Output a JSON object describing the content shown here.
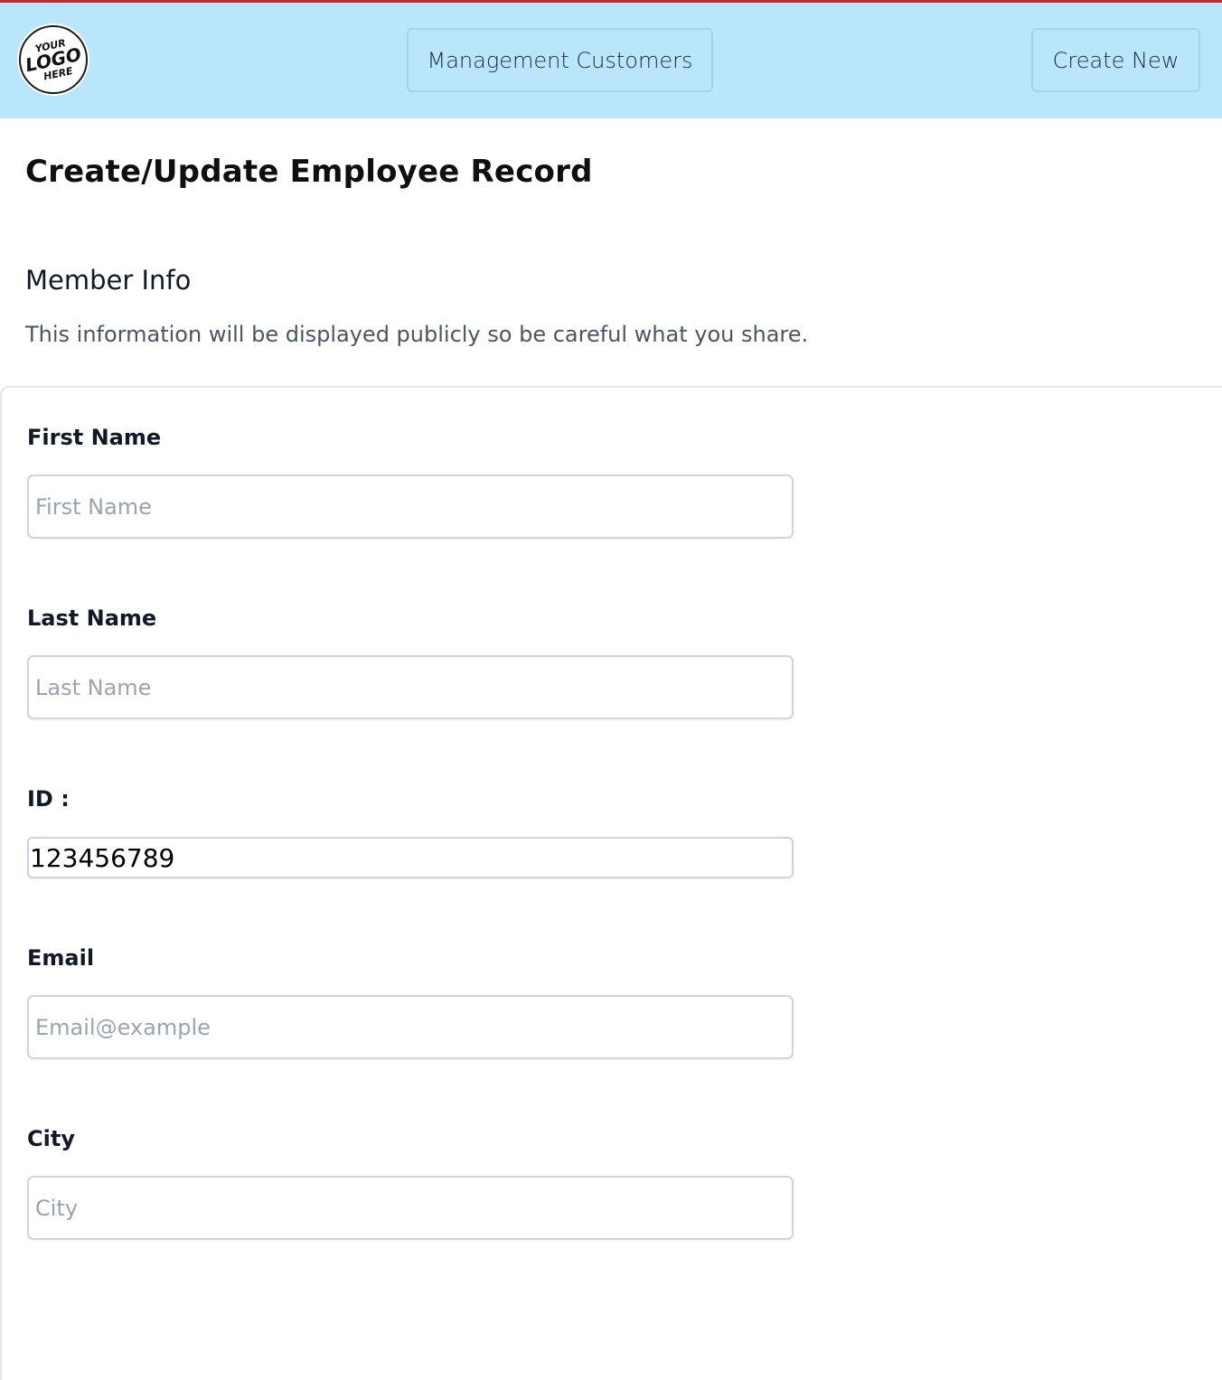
{
  "header": {
    "logo_text": [
      "YOUR",
      "LOGO",
      "HERE"
    ],
    "nav": {
      "management_label": "Management Customers",
      "create_label": "Create New"
    }
  },
  "page": {
    "title": "Create/Update Employee Record"
  },
  "section": {
    "title": "Member Info",
    "description": "This information will be displayed publicly so be careful what you share."
  },
  "form": {
    "first_name": {
      "label": "First Name",
      "placeholder": "First Name",
      "value": ""
    },
    "last_name": {
      "label": "Last Name",
      "placeholder": "Last Name",
      "value": ""
    },
    "id": {
      "label": "ID :",
      "value": "123456789"
    },
    "email": {
      "label": "Email",
      "placeholder": "Email@example",
      "value": ""
    },
    "city": {
      "label": "City",
      "placeholder": "City",
      "value": ""
    }
  },
  "colors": {
    "header_bg": "#b9e6fb",
    "top_border": "#c62828",
    "button_border": "#9fd3ee",
    "input_border": "#d1d5db",
    "placeholder": "#9aa3b2"
  }
}
